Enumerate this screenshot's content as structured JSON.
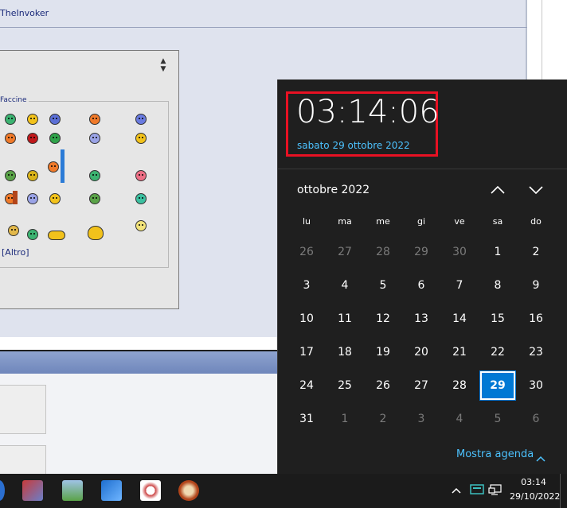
{
  "background_window": {
    "username_fragment": "TheInvoker",
    "smilies_legend": "Faccine",
    "more_smilies_link": "[Altro]"
  },
  "clock": {
    "time": "03:14:06",
    "date_long": "sabato 29 ottobre 2022"
  },
  "calendar": {
    "month_label": "ottobre 2022",
    "weekdays": [
      "lu",
      "ma",
      "me",
      "gi",
      "ve",
      "sa",
      "do"
    ],
    "weeks": [
      [
        {
          "d": "26",
          "m": true
        },
        {
          "d": "27",
          "m": true
        },
        {
          "d": "28",
          "m": true
        },
        {
          "d": "29",
          "m": true
        },
        {
          "d": "30",
          "m": true
        },
        {
          "d": "1",
          "m": false
        },
        {
          "d": "2",
          "m": false
        }
      ],
      [
        {
          "d": "3",
          "m": false
        },
        {
          "d": "4",
          "m": false
        },
        {
          "d": "5",
          "m": false
        },
        {
          "d": "6",
          "m": false
        },
        {
          "d": "7",
          "m": false
        },
        {
          "d": "8",
          "m": false
        },
        {
          "d": "9",
          "m": false
        }
      ],
      [
        {
          "d": "10",
          "m": false
        },
        {
          "d": "11",
          "m": false
        },
        {
          "d": "12",
          "m": false
        },
        {
          "d": "13",
          "m": false
        },
        {
          "d": "14",
          "m": false
        },
        {
          "d": "15",
          "m": false
        },
        {
          "d": "16",
          "m": false
        }
      ],
      [
        {
          "d": "17",
          "m": false
        },
        {
          "d": "18",
          "m": false
        },
        {
          "d": "19",
          "m": false
        },
        {
          "d": "20",
          "m": false
        },
        {
          "d": "21",
          "m": false
        },
        {
          "d": "22",
          "m": false
        },
        {
          "d": "23",
          "m": false
        }
      ],
      [
        {
          "d": "24",
          "m": false
        },
        {
          "d": "25",
          "m": false
        },
        {
          "d": "26",
          "m": false
        },
        {
          "d": "27",
          "m": false
        },
        {
          "d": "28",
          "m": false
        },
        {
          "d": "29",
          "m": false,
          "today": true
        },
        {
          "d": "30",
          "m": false
        }
      ],
      [
        {
          "d": "31",
          "m": false
        },
        {
          "d": "1",
          "m": true
        },
        {
          "d": "2",
          "m": true
        },
        {
          "d": "3",
          "m": true
        },
        {
          "d": "4",
          "m": true
        },
        {
          "d": "5",
          "m": true
        },
        {
          "d": "6",
          "m": true
        }
      ]
    ],
    "show_agenda_label": "Mostra agenda",
    "accent_color": "#0078d4",
    "highlight_color": "#e81123"
  },
  "taskbar": {
    "time": "03:14",
    "date": "29/10/2022",
    "apps": [
      "winrar-icon",
      "package-icon",
      "phone-icon",
      "satellite-dish-icon",
      "archive-icon"
    ]
  }
}
